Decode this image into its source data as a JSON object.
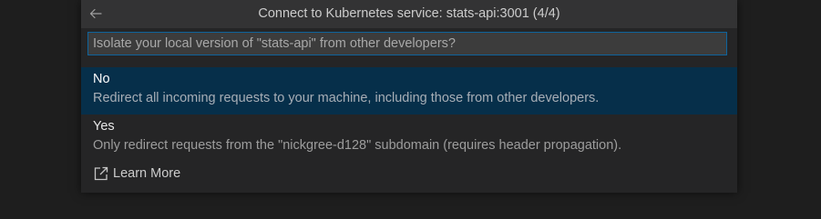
{
  "quick_pick": {
    "title": "Connect to Kubernetes service: stats-api:3001 (4/4)",
    "back_icon": "arrow-left-icon",
    "input": {
      "value": "",
      "placeholder": "Isolate your local version of \"stats-api\" from other developers?"
    },
    "items": [
      {
        "label": "No",
        "detail": "Redirect all incoming requests to your machine, including those from other developers.",
        "selected": true
      },
      {
        "label": "Yes",
        "detail": "Only redirect requests from the \"nickgree-d128\" subdomain (requires header propagation).",
        "selected": false
      }
    ],
    "learn_more": {
      "label": "Learn More",
      "icon": "external-link-icon"
    }
  },
  "colors": {
    "background": "#1e1e1e",
    "panel": "#252526",
    "title_bar": "#333334",
    "input_border": "#0e639c",
    "selected_row": "#062f4a"
  }
}
